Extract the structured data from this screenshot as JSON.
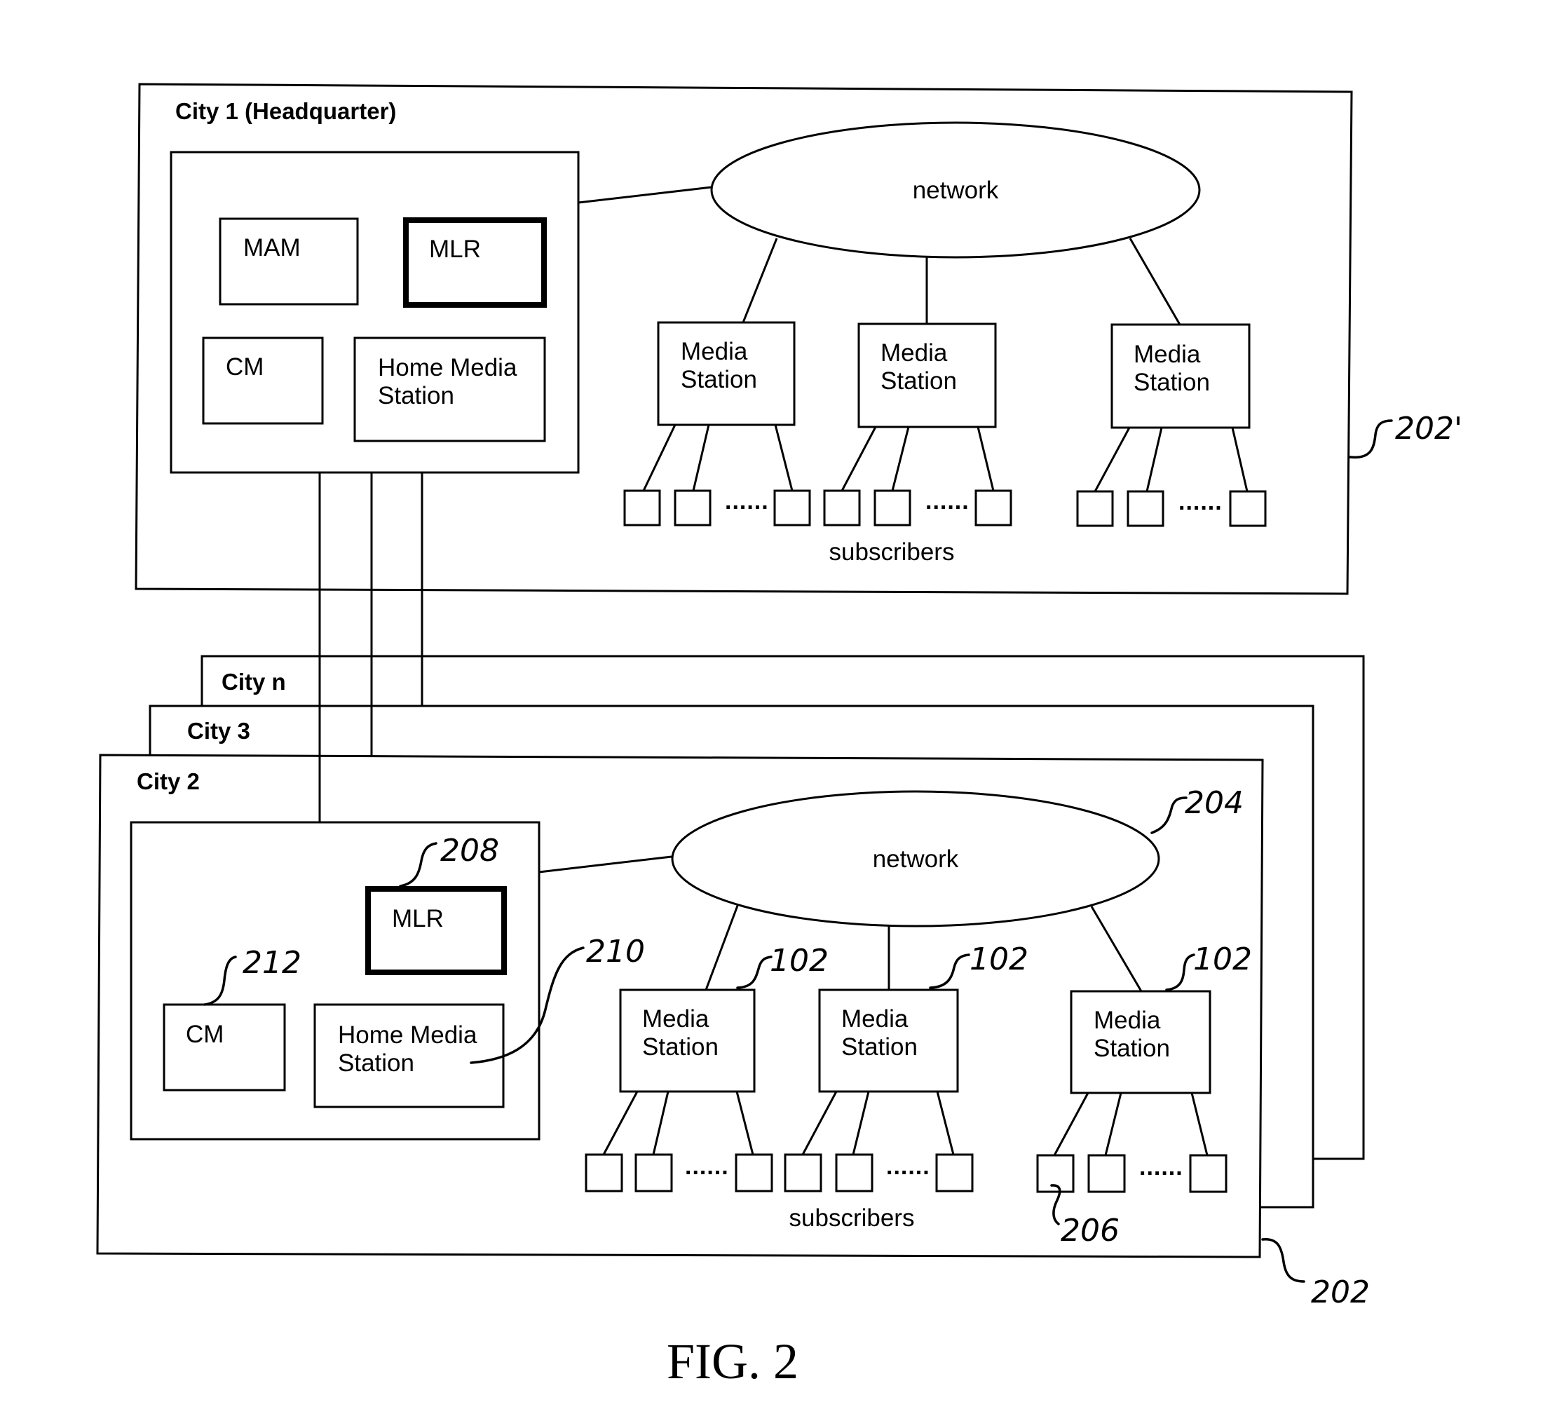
{
  "figure": {
    "caption": "FIG. 2"
  },
  "headquarters": {
    "title": "City 1 (Headquarter)",
    "ref_label": "202'",
    "components": {
      "mam": "MAM",
      "mlr": "MLR",
      "cm": "CM",
      "home_media_station": [
        "Home Media",
        "Station"
      ]
    },
    "network_label": "network",
    "media_stations": [
      {
        "line1": "Media",
        "line2": "Station"
      },
      {
        "line1": "Media",
        "line2": "Station"
      },
      {
        "line1": "Media",
        "line2": "Station"
      }
    ],
    "subscriber_ellipsis": "......",
    "subscribers_label": "subscribers"
  },
  "stacked_cities": [
    {
      "title": "City n"
    },
    {
      "title": "City 3"
    }
  ],
  "city2": {
    "title": "City 2",
    "ref_label": "202",
    "components": {
      "mlr": "MLR",
      "mlr_ref": "208",
      "cm": "CM",
      "cm_ref": "212",
      "home_media_station": [
        "Home Media",
        "Station"
      ],
      "home_media_station_ref": "210"
    },
    "network_label": "network",
    "network_ref": "204",
    "media_stations": [
      {
        "line1": "Media",
        "line2": "Station",
        "ref": "102"
      },
      {
        "line1": "Media",
        "line2": "Station",
        "ref": "102"
      },
      {
        "line1": "Media",
        "line2": "Station",
        "ref": "102"
      }
    ],
    "subscriber_ellipsis": "......",
    "subscribers_label": "subscribers",
    "subscriber_ref": "206"
  }
}
